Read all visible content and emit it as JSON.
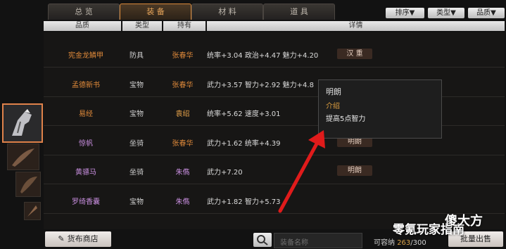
{
  "tabs": [
    {
      "label": "总 览",
      "active": false
    },
    {
      "label": "装 备",
      "active": true
    },
    {
      "label": "材 料",
      "active": false
    },
    {
      "label": "道 具",
      "active": false
    }
  ],
  "sort_buttons": [
    "排序▼",
    "类型▼",
    "品质▼"
  ],
  "headers": [
    "品质",
    "类型",
    "持有",
    "详情"
  ],
  "rows": [
    {
      "name": "宪金龙鳞甲",
      "type": "防具",
      "owner": "张春华",
      "detail": "统率+3.04  政治+4.47  魅力+4.20",
      "tag": "汉 重"
    },
    {
      "name": "孟德新书",
      "type": "宝物",
      "owner": "张春华",
      "detail": "武力+3.57  智力+2.92  魅力+4.8",
      "tag": ""
    },
    {
      "name": "易经",
      "type": "宝物",
      "owner": "袁绍",
      "detail": "统率+5.62  速度+3.01",
      "tag": ""
    },
    {
      "name": "惊帆",
      "type": "坐骑",
      "owner": "张春华",
      "detail": "武力+1.62  统率+4.39",
      "tag": "明朗"
    },
    {
      "name": "黄骠马",
      "type": "坐骑",
      "owner": "朱儁",
      "detail": "武力+7.20",
      "tag": "明朗"
    },
    {
      "name": "罗绮香囊",
      "type": "宝物",
      "owner": "朱儁",
      "detail": "武力+1.82  智力+5.73",
      "tag": ""
    }
  ],
  "popup": {
    "title": "明朗",
    "section": "介绍",
    "desc": "提高5点智力"
  },
  "bottom": {
    "shop_button": "货布商店",
    "search_placeholder": "装备名称",
    "capacity_label": "可容纳",
    "capacity_used": "263",
    "capacity_total": "/300",
    "sell_button": "批量出售"
  },
  "watermark": "零氪玩家指南",
  "watermark2": "傻大方",
  "icons": {
    "search": "search-icon",
    "shop": "feather-icon"
  },
  "colors": {
    "accent": "#e08a3a",
    "purple": "#c98fe0",
    "arrow": "#e01b1b"
  }
}
